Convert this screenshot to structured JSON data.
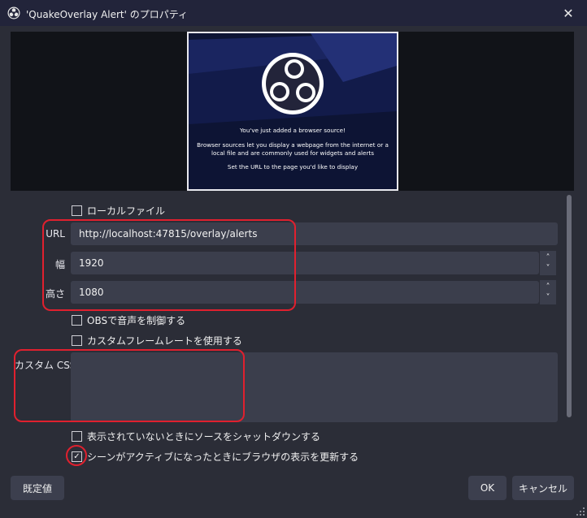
{
  "window": {
    "title": "'QuakeOverlay Alert' のプロパティ",
    "close_glyph": "✕"
  },
  "preview": {
    "line1": "You've just added a browser source!",
    "line2": "Browser sources let you display a webpage from the internet or a local file and are commonly used for widgets and alerts",
    "line3": "Set the URL to the page you'd like to display"
  },
  "form": {
    "local_file_label": "ローカルファイル",
    "local_file_checked": false,
    "url_label": "URL",
    "url_value": "http://localhost:47815/overlay/alerts",
    "width_label": "幅",
    "width_value": "1920",
    "height_label": "高さ",
    "height_value": "1080",
    "spin_up": "˄",
    "spin_down": "˅",
    "audio_label": "OBSで音声を制御する",
    "audio_checked": false,
    "framerate_label": "カスタムフレームレートを使用する",
    "framerate_checked": false,
    "css_label": "カスタム CSS",
    "css_value": "",
    "shutdown_label": "表示されていないときにソースをシャットダウンする",
    "shutdown_checked": false,
    "refresh_label": "シーンがアクティブになったときにブラウザの表示を更新する",
    "refresh_checked": true,
    "check_glyph": "✓"
  },
  "buttons": {
    "defaults": "既定値",
    "ok": "OK",
    "cancel": "キャンセル"
  },
  "icons": {
    "app": "obs-logo-icon",
    "close": "close-icon",
    "resize": "resize-grip-icon"
  },
  "colors": {
    "highlight": "#e0202e",
    "panel": "#2b2d37",
    "field": "#3b3e4c",
    "titlebar": "#22243a"
  }
}
